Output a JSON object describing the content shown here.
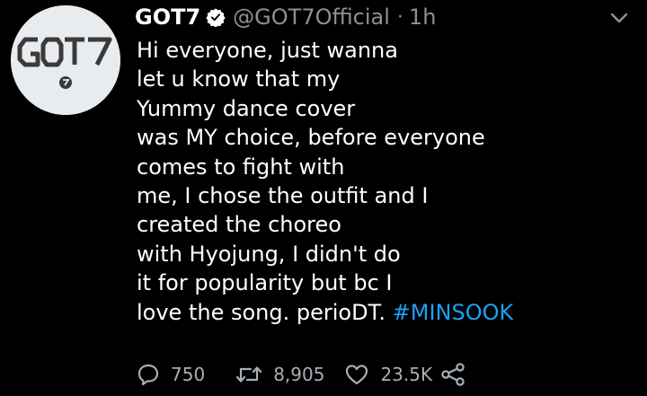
{
  "tweet": {
    "display_name": "GOT7",
    "handle": "@GOT7Official",
    "separator": "·",
    "time": "1h",
    "avatar_logo": "GOT7",
    "body_lines": [
      "Hi everyone, just wanna",
      "let u know that my",
      "Yummy dance cover",
      "was MY choice, before everyone",
      "comes to fight with",
      "me, I chose the outfit and I",
      "created the choreo",
      "with Hyojung, I didn't do",
      "it for popularity but bc I"
    ],
    "last_line_text": "love the song. perioDT.",
    "hashtag": "#MINSOOK",
    "actions": {
      "replies": "750",
      "retweets": "8,905",
      "likes": "23.5K"
    },
    "icons": {
      "verified": "verified-badge-icon",
      "menu": "chevron-down-icon",
      "reply": "reply-bubble-icon",
      "retweet": "retweet-icon",
      "like": "heart-icon",
      "share": "share-icon"
    },
    "colors": {
      "background": "#000000",
      "text": "#ffffff",
      "muted": "#8a9199",
      "link": "#1da1f2",
      "avatar_bg": "#e9ecef"
    }
  }
}
